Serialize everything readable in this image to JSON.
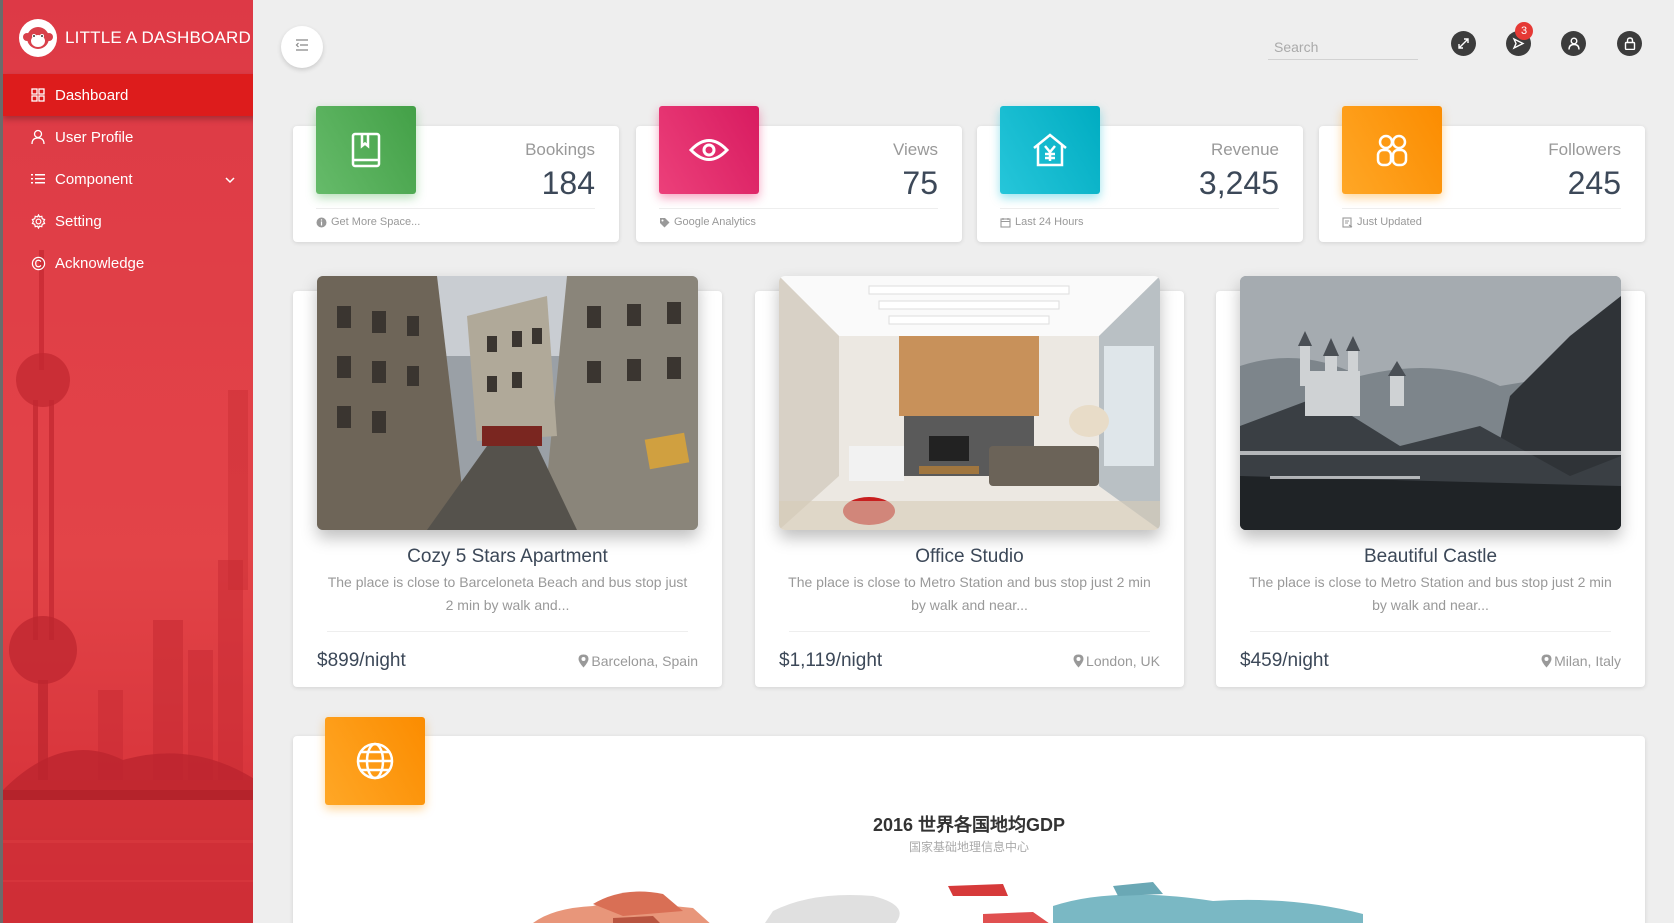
{
  "sidebar": {
    "brand": "LITTLE A DASHBOARD",
    "items": [
      {
        "label": "Dashboard",
        "icon": "dashboard-grid-icon",
        "active": true
      },
      {
        "label": "User Profile",
        "icon": "user-icon"
      },
      {
        "label": "Component",
        "icon": "list-icon"
      },
      {
        "label": "Setting",
        "icon": "gear-icon"
      },
      {
        "label": "Acknowledge",
        "icon": "copyright-icon"
      }
    ]
  },
  "header": {
    "search_placeholder": "Search",
    "notification_count": "3",
    "icons": [
      "fullscreen-icon",
      "notification-icon",
      "user-icon",
      "lock-icon"
    ]
  },
  "stats": [
    {
      "label": "Bookings",
      "value": "184",
      "footer": "Get More Space...",
      "color_a": "#66bb6a",
      "color_b": "#43a047",
      "icon": "book-icon",
      "footer_icon": "info-icon"
    },
    {
      "label": "Views",
      "value": "75",
      "footer": "Google Analytics",
      "color_a": "#ec407a",
      "color_b": "#d81b60",
      "icon": "eye-icon",
      "footer_icon": "tag-icon"
    },
    {
      "label": "Revenue",
      "value": "3,245",
      "footer": "Last 24 Hours",
      "color_a": "#26c6da",
      "color_b": "#00acc1",
      "icon": "yen-house-icon",
      "footer_icon": "calendar-icon"
    },
    {
      "label": "Followers",
      "value": "245",
      "footer": "Just Updated",
      "color_a": "#ffa726",
      "color_b": "#fb8c00",
      "icon": "group-icon",
      "footer_icon": "update-icon"
    }
  ],
  "properties": [
    {
      "title": "Cozy 5 Stars Apartment",
      "desc": "The place is close to Barceloneta Beach and bus stop just 2 min by walk and...",
      "price": "$899/night",
      "location": "Barcelona, Spain"
    },
    {
      "title": "Office Studio",
      "desc": "The place is close to Metro Station and bus stop just 2 min by walk and near...",
      "price": "$1,119/night",
      "location": "London, UK"
    },
    {
      "title": "Beautiful Castle",
      "desc": "The place is close to Metro Station and bus stop just 2 min by walk and near...",
      "price": "$459/night",
      "location": "Milan, Italy"
    }
  ],
  "map": {
    "title": "2016 世界各国地均GDP",
    "subtitle": "国家基础地理信息中心",
    "icon": "globe-icon"
  }
}
